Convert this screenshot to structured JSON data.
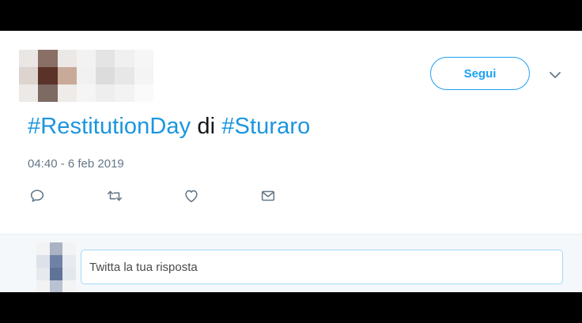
{
  "tweet": {
    "hashtag_1": "#RestitutionDay",
    "connector": " di ",
    "hashtag_2": "#Sturaro",
    "timestamp": "04:40 - 6 feb 2019"
  },
  "header": {
    "follow_label": "Segui",
    "more_icon": "chevron-down-icon"
  },
  "actions": {
    "icons": [
      "reply-icon",
      "retweet-icon",
      "like-icon",
      "message-icon"
    ]
  },
  "reply": {
    "placeholder": "Twitta la tua risposta"
  },
  "colors": {
    "accent": "#1da1f2",
    "hashtag": "#1b95e0",
    "text": "#14171a",
    "muted": "#657786",
    "reply_bg": "#f5f8fa"
  }
}
